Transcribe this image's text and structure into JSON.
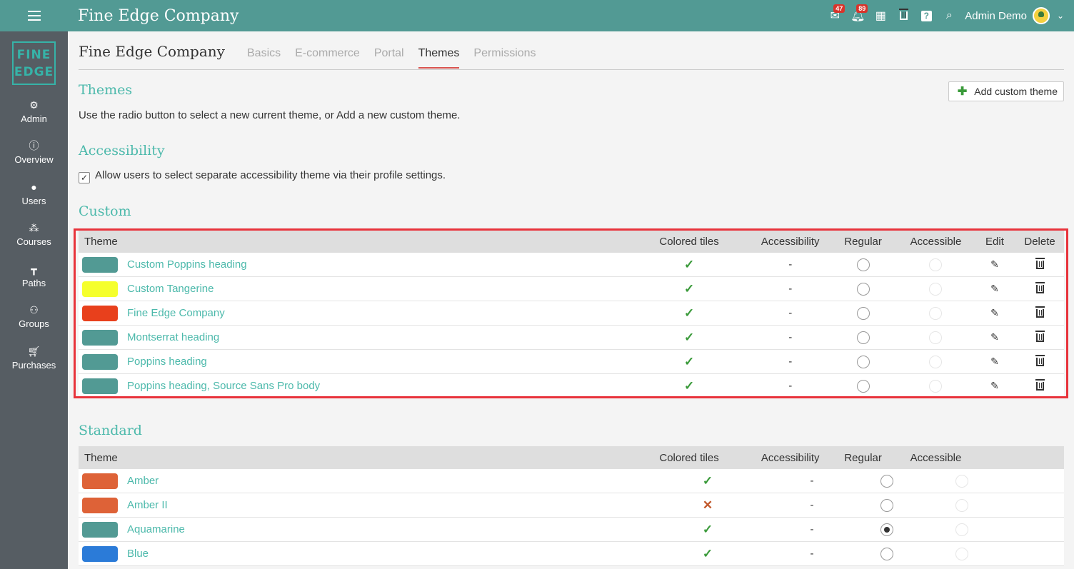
{
  "topbar": {
    "title": "Fine Edge Company",
    "messages_badge": "47",
    "notifications_badge": "89",
    "user_name": "Admin Demo"
  },
  "sidebar": {
    "logo_line1": "FINE",
    "logo_line2": "EDGE",
    "items": [
      {
        "label": "Admin",
        "icon": "gear-icon"
      },
      {
        "label": "Overview",
        "icon": "info-icon"
      },
      {
        "label": "Users",
        "icon": "user-icon"
      },
      {
        "label": "Courses",
        "icon": "courses-icon"
      },
      {
        "label": "Paths",
        "icon": "signpost-icon"
      },
      {
        "label": "Groups",
        "icon": "group-icon"
      },
      {
        "label": "Purchases",
        "icon": "cart-icon"
      }
    ]
  },
  "page": {
    "company_title": "Fine Edge Company",
    "tabs": [
      "Basics",
      "E-commerce",
      "Portal",
      "Themes",
      "Permissions"
    ],
    "active_tab": "Themes",
    "themes_title": "Themes",
    "add_button": "Add custom theme",
    "themes_desc": "Use the radio button to select a new current theme, or Add a new custom theme.",
    "accessibility_title": "Accessibility",
    "accessibility_checkbox": "Allow users to select separate accessibility theme via their profile settings.",
    "custom_title": "Custom",
    "standard_title": "Standard"
  },
  "custom_table": {
    "headers": {
      "theme": "Theme",
      "tiles": "Colored tiles",
      "accessibility": "Accessibility",
      "regular": "Regular",
      "accessible": "Accessible",
      "edit": "Edit",
      "delete": "Delete"
    },
    "rows": [
      {
        "name": "Custom Poppins heading",
        "color": "#529a94",
        "tiles": "✓",
        "accessibility": "-"
      },
      {
        "name": "Custom Tangerine",
        "color": "#f5ff2d",
        "tiles": "✓",
        "accessibility": "-"
      },
      {
        "name": "Fine Edge Company",
        "color": "#e8401c",
        "tiles": "✓",
        "accessibility": "-"
      },
      {
        "name": "Montserrat heading",
        "color": "#529a94",
        "tiles": "✓",
        "accessibility": "-"
      },
      {
        "name": "Poppins heading",
        "color": "#529a94",
        "tiles": "✓",
        "accessibility": "-"
      },
      {
        "name": "Poppins heading, Source Sans Pro body",
        "color": "#529a94",
        "tiles": "✓",
        "accessibility": "-"
      }
    ]
  },
  "standard_table": {
    "headers": {
      "theme": "Theme",
      "tiles": "Colored tiles",
      "accessibility": "Accessibility",
      "regular": "Regular",
      "accessible": "Accessible"
    },
    "rows": [
      {
        "name": "Amber",
        "color": "#de6237",
        "tiles": "✓",
        "accessibility": "-"
      },
      {
        "name": "Amber II",
        "color": "#de6237",
        "tiles": "✕",
        "accessibility": "-"
      },
      {
        "name": "Aquamarine",
        "color": "#529a94",
        "tiles": "✓",
        "accessibility": "-"
      },
      {
        "name": "Blue",
        "color": "#2b7bd8",
        "tiles": "✓",
        "accessibility": "-"
      }
    ]
  }
}
